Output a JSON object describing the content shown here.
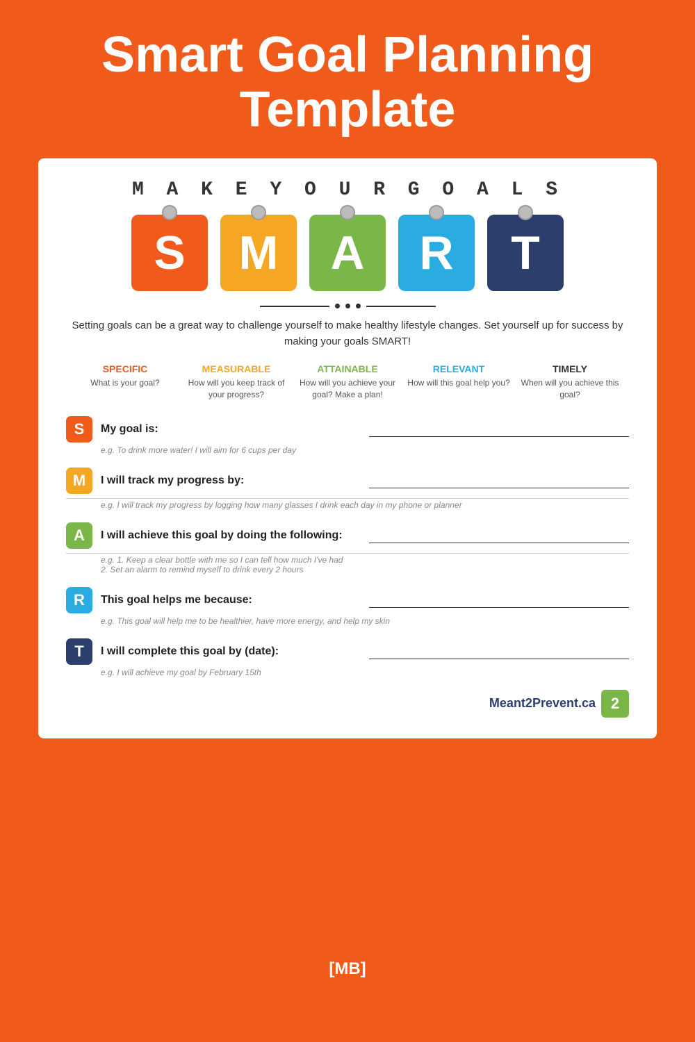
{
  "header": {
    "title": "Smart Goal Planning Template"
  },
  "make_your_goals": "M A K E   Y O U R   G O A L S",
  "smart_letters": [
    "S",
    "M",
    "A",
    "R",
    "T"
  ],
  "intro_text": "Setting goals can be a great way to challenge yourself to make healthy lifestyle changes. Set yourself up for success by making your goals SMART!",
  "smart_definitions": [
    {
      "title": "SPECIFIC",
      "desc": "What is your goal?",
      "color_class": "specific-title"
    },
    {
      "title": "MEASURABLE",
      "desc": "How will you keep track of your progress?",
      "color_class": "measurable-title"
    },
    {
      "title": "ATTAINABLE",
      "desc": "How will you achieve your goal? Make a plan!",
      "color_class": "attainable-title"
    },
    {
      "title": "RELEVANT",
      "desc": "How will this goal help you?",
      "color_class": "relevant-title"
    },
    {
      "title": "TIMELY",
      "desc": "When will you achieve this goal?",
      "color_class": "timely-title"
    }
  ],
  "form_sections": [
    {
      "letter": "S",
      "color_class": "s-box",
      "label": "My goal is:",
      "example": "e.g. To drink more water! I will aim for 6 cups per day",
      "has_second_line": false
    },
    {
      "letter": "M",
      "color_class": "m-box",
      "label": "I will track my progress by:",
      "example": "e.g. I will track my progress by logging how many glasses I drink each day in my phone or planner",
      "has_second_line": true
    },
    {
      "letter": "A",
      "color_class": "a-box",
      "label": "I will achieve this goal by doing the following:",
      "example": "e.g. 1. Keep a clear bottle with me so I can tell how much I've had\n      2. Set an alarm to remind myself to drink every 2 hours",
      "has_second_line": true
    },
    {
      "letter": "R",
      "color_class": "r-box",
      "label": "This goal helps me because:",
      "example": "e.g. This goal will help me to be healthier, have more energy, and help my skin",
      "has_second_line": false
    },
    {
      "letter": "T",
      "color_class": "t-box",
      "label": "I will complete this goal by (date):",
      "example": "e.g. I will achieve my goal by February 15th",
      "has_second_line": false
    }
  ],
  "footer": {
    "brand": "Meant2Prevent.ca",
    "badge_number": "2"
  },
  "bottom_badge": "[MB]"
}
